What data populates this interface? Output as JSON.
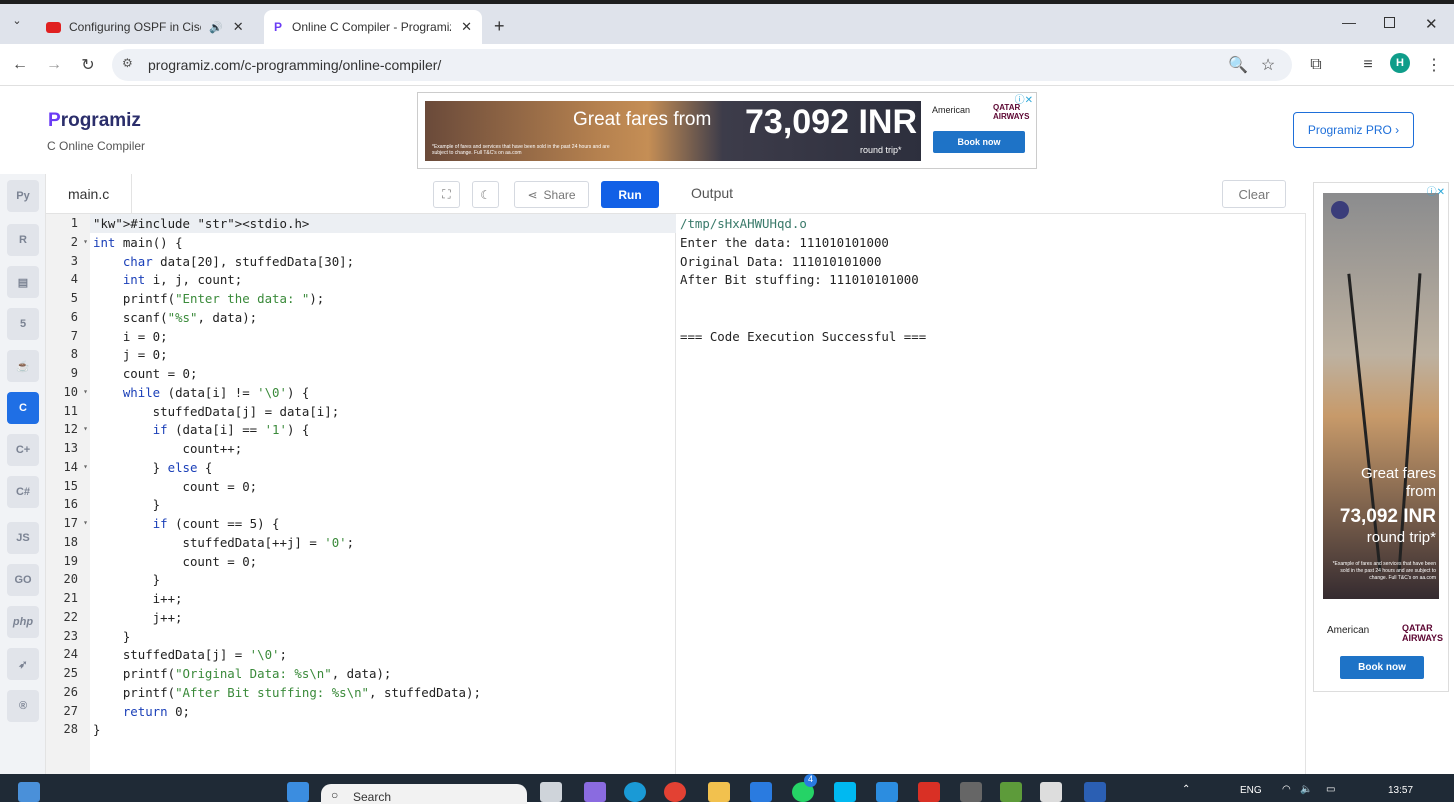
{
  "browser": {
    "tabs": [
      {
        "title": "Configuring OSPF in Cisco |",
        "icon": "youtube-icon"
      },
      {
        "title": "Online C Compiler - Programiz",
        "icon": "programiz-icon"
      }
    ],
    "url": "programiz.com/c-programming/online-compiler/",
    "profile_initial": "H"
  },
  "header": {
    "logo": "rogramiz",
    "logo_prefix": "P",
    "subtitle": "C Online Compiler",
    "pro_button": "Programiz PRO ›"
  },
  "ad_top": {
    "headline": "Great fares from",
    "price": "73,092 INR",
    "round_trip": "round trip*",
    "fine_print": "*Example of fares and services that have been sold in the past 24 hours and are subject to change. Full T&C's on aa.com",
    "airline1": "American",
    "airline2": "QATAR AIRWAYS",
    "cta": "Book now"
  },
  "editor": {
    "file_tab": "main.c",
    "share": "Share",
    "run": "Run",
    "lines": [
      "#include <stdio.h>",
      "int main() {",
      "    char data[20], stuffedData[30];",
      "    int i, j, count;",
      "    printf(\"Enter the data: \");",
      "    scanf(\"%s\", data);",
      "    i = 0;",
      "    j = 0;",
      "    count = 0;",
      "    while (data[i] != '\\0') {",
      "        stuffedData[j] = data[i];",
      "        if (data[i] == '1') {",
      "            count++;",
      "        } else {",
      "            count = 0;",
      "        }",
      "        if (count == 5) {",
      "            stuffedData[++j] = '0';",
      "            count = 0;",
      "        }",
      "        i++;",
      "        j++;",
      "    }",
      "    stuffedData[j] = '\\0';",
      "    printf(\"Original Data: %s\\n\", data);",
      "    printf(\"After Bit stuffing: %s\\n\", stuffedData);",
      "    return 0;",
      "}"
    ],
    "line_numbers": [
      "1",
      "2",
      "3",
      "4",
      "5",
      "6",
      "7",
      "8",
      "9",
      "10",
      "11",
      "12",
      "13",
      "14",
      "15",
      "16",
      "17",
      "18",
      "19",
      "20",
      "21",
      "22",
      "23",
      "24",
      "25",
      "26",
      "27",
      "28"
    ],
    "fold_lines": [
      2,
      10,
      12,
      14,
      17
    ]
  },
  "output": {
    "title": "Output",
    "clear": "Clear",
    "lines": [
      "/tmp/sHxAHWUHqd.o",
      "Enter the data: 111010101000",
      "Original Data: 111010101000",
      "After Bit stuffing: 111010101000",
      "",
      "",
      "=== Code Execution Successful ==="
    ]
  },
  "ad_side": {
    "line1": "Great fares from",
    "price": "73,092 INR",
    "round_trip": "round trip*",
    "fine_print": "*Example of fares and services that have been sold in the past 24 hours and are subject to change. Full T&C's on aa.com",
    "airline1": "American",
    "airline2": "QATAR AIRWAYS",
    "cta": "Book now"
  },
  "taskbar": {
    "search": "Search",
    "lang": "ENG",
    "time": "13:57",
    "whatsapp_badge": "4"
  },
  "colors": {
    "accent": "#1260e6",
    "brand": "#2b2e6b"
  }
}
